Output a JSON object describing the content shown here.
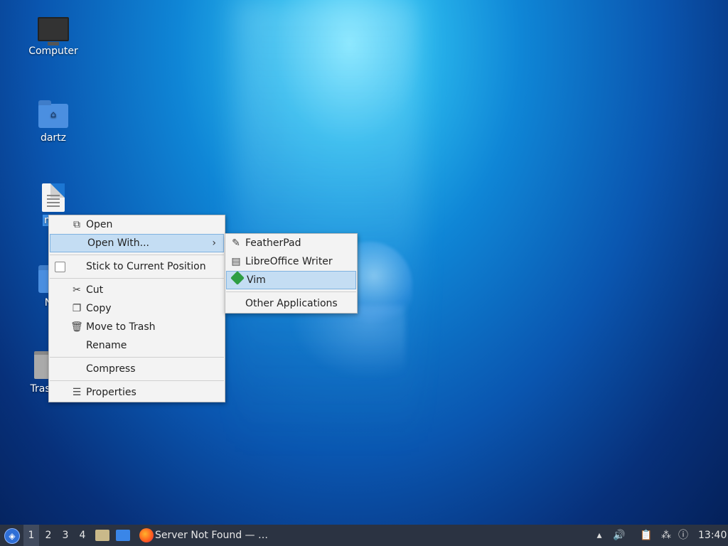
{
  "desktop": {
    "icons": [
      {
        "label": "Computer",
        "icon": "monitor-icon"
      },
      {
        "label": "dartz",
        "icon": "home-folder-icon"
      },
      {
        "label": "mai",
        "icon": "text-file-icon"
      },
      {
        "label": "Net",
        "icon": "network-folder-icon"
      },
      {
        "label": "Trash",
        "icon": "trash-icon"
      }
    ]
  },
  "context_menu": {
    "open": "Open",
    "open_with": "Open With...",
    "stick": "Stick to Current Position",
    "cut": "Cut",
    "copy": "Copy",
    "move_to_trash": "Move to Trash",
    "rename": "Rename",
    "compress": "Compress",
    "properties": "Properties"
  },
  "open_with_menu": {
    "items": [
      "FeatherPad",
      "LibreOffice Writer",
      "Vim"
    ],
    "other": "Other Applications",
    "highlighted": "Vim"
  },
  "taskbar": {
    "workspaces": [
      "1",
      "2",
      "3",
      "4"
    ],
    "active_workspace": "1",
    "window_title": "Server Not Found — …",
    "clock": "13:40"
  },
  "colors": {
    "taskbar_bg": "#2b3342",
    "menu_bg": "#f3f3f3",
    "highlight": "#c4ddf3",
    "selection": "#3c8fe6"
  }
}
